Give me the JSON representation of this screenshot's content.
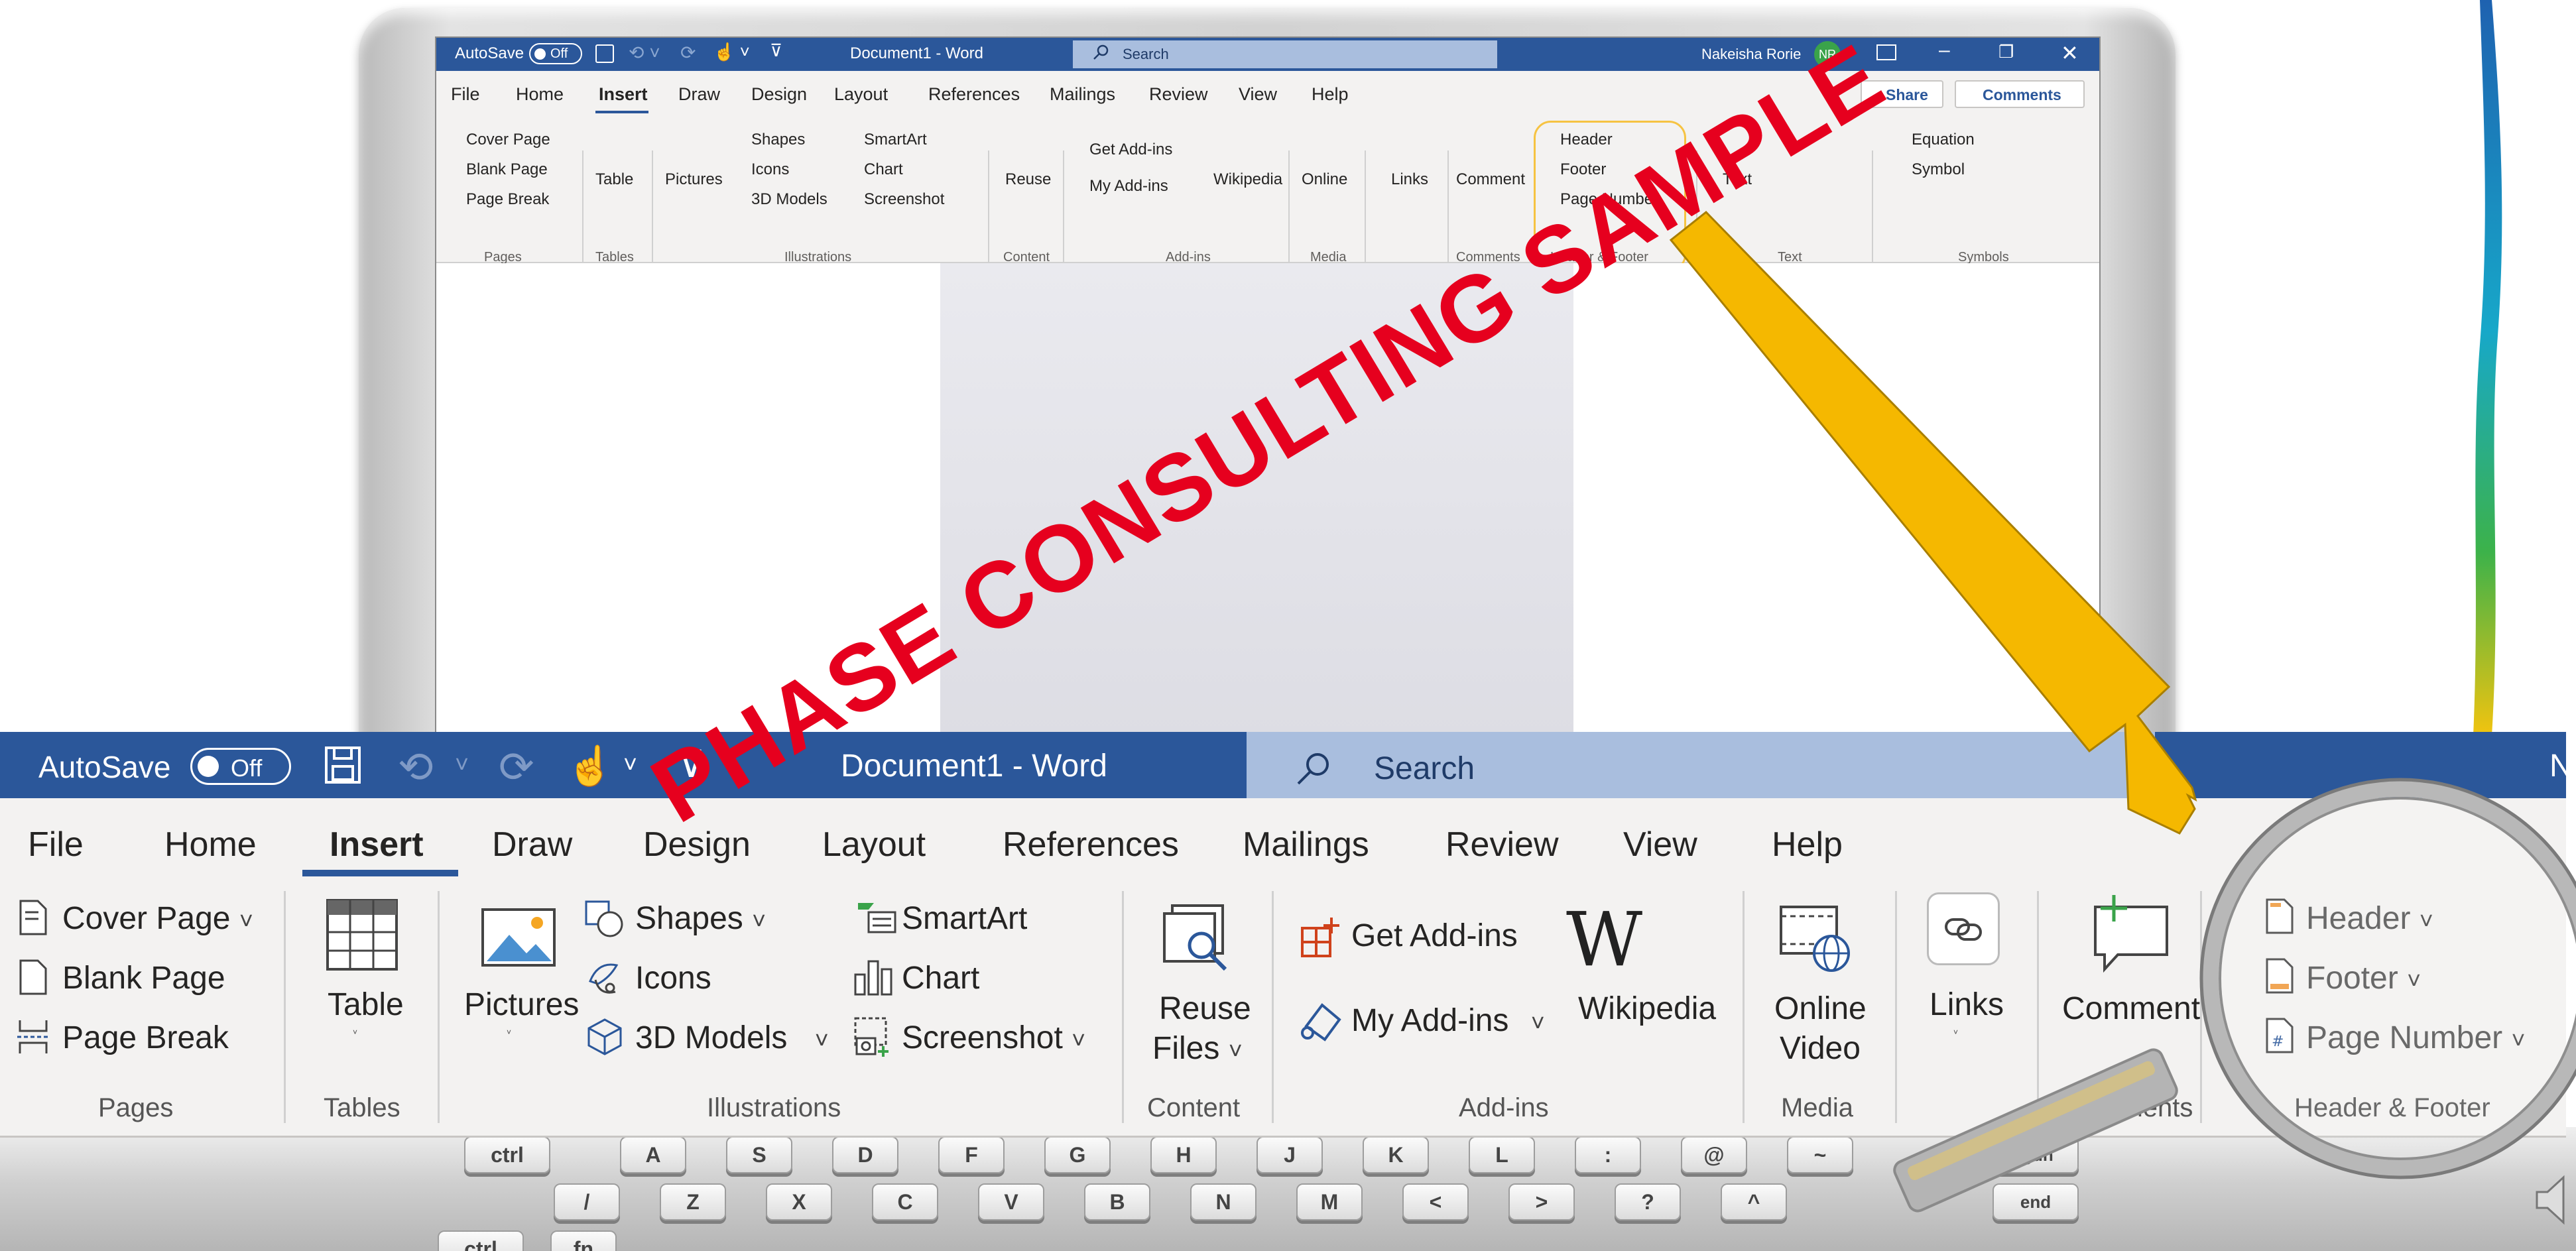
{
  "window": {
    "autosave_label": "AutoSave",
    "autosave_state": "Off",
    "doc_title": "Document1  -  Word",
    "small_doc_title": "Document1 - Word",
    "search_placeholder": "Search",
    "user_name": "Nakeisha Rorie",
    "user_initials": "NR",
    "user_initial_cut": "N"
  },
  "tabs": [
    "File",
    "Home",
    "Insert",
    "Draw",
    "Design",
    "Layout",
    "References",
    "Mailings",
    "Review",
    "View",
    "Help"
  ],
  "active_tab": "Insert",
  "share_label": "Share",
  "comments_label": "Comments",
  "pages": {
    "cover_page": "Cover Page",
    "blank_page": "Blank Page",
    "page_break": "Page Break",
    "group": "Pages"
  },
  "tables": {
    "table": "Table",
    "group": "Tables"
  },
  "illustrations": {
    "pictures": "Pictures",
    "shapes": "Shapes",
    "icons": "Icons",
    "models": "3D Models",
    "smartart": "SmartArt",
    "chart": "Chart",
    "screenshot": "Screenshot",
    "group": "Illustrations"
  },
  "content": {
    "reuse": "Reuse",
    "files": "Files",
    "group": "Content"
  },
  "addins": {
    "get": "Get Add-ins",
    "my": "My Add-ins",
    "wikipedia": "Wikipedia",
    "group": "Add-ins"
  },
  "media": {
    "online": "Online",
    "video": "Video",
    "group": "Media"
  },
  "links": {
    "label": "Links"
  },
  "comments": {
    "label": "Comment",
    "group": "Comments"
  },
  "header_footer": {
    "header": "Header",
    "footer": "Footer",
    "page_number": "Page Number",
    "group": "Header & Footer"
  },
  "text": {
    "text": "Text",
    "box": "Box",
    "group": "Text"
  },
  "symbols": {
    "equation": "Equation",
    "symbol": "Symbol",
    "group": "Symbols"
  },
  "keyboard": {
    "row1": [
      "ctrl",
      "A",
      "S",
      "D",
      "F",
      "G",
      "H",
      "J",
      "K",
      "L",
      ":",
      "@",
      "~",
      "pgdn"
    ],
    "row2": [
      "/",
      "Z",
      "X",
      "C",
      "V",
      "B",
      "N",
      "M",
      "<",
      ">",
      "?",
      "^",
      "end"
    ],
    "row3": [
      "ctrl",
      "fn"
    ]
  },
  "watermark": "PHASE CONSULTING SAMPLE",
  "colors": {
    "title_bar": "#2b579a",
    "ribbon": "#f3f2f1",
    "accent": "#2b579a",
    "watermark": "#e6001e",
    "arrow": "#f5b800",
    "highlight": "#f6c342"
  }
}
